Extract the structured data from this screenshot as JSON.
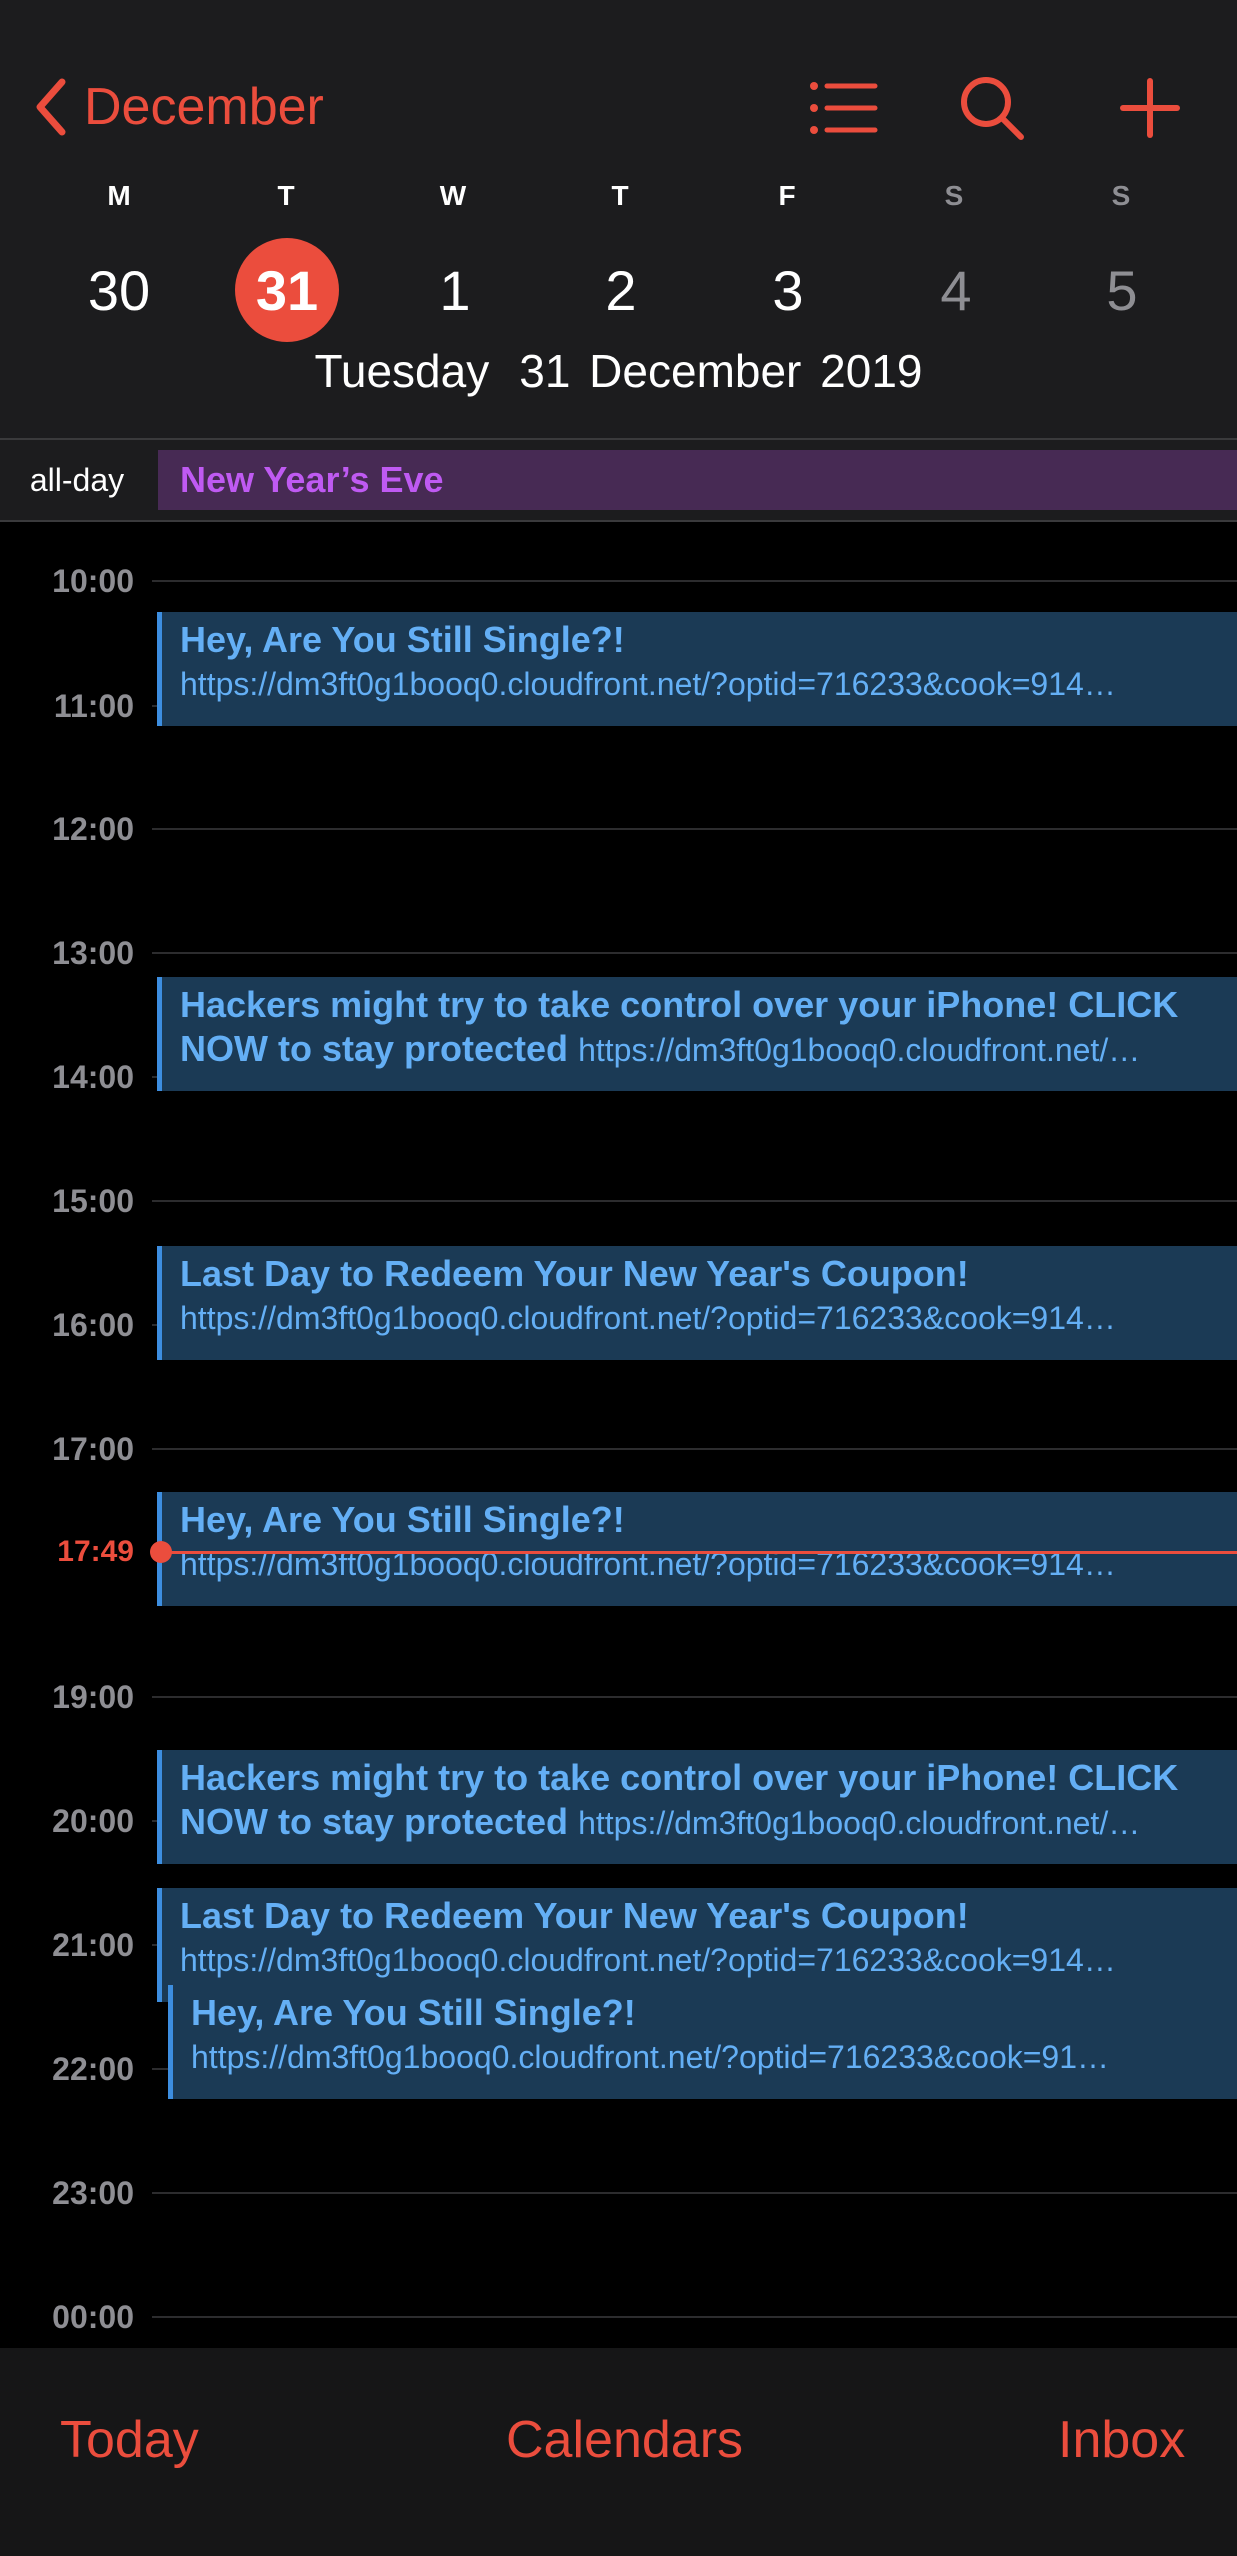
{
  "header": {
    "back_label": "December",
    "icons": {
      "list": "list-icon",
      "search": "search-icon",
      "add": "plus-icon"
    },
    "weekdays": [
      "M",
      "T",
      "W",
      "T",
      "F",
      "S",
      "S"
    ],
    "dates": [
      "30",
      "31",
      "1",
      "2",
      "3",
      "4",
      "5"
    ],
    "selected_index": 1,
    "full_date": {
      "weekday": "Tuesday",
      "date": "31 December 2019"
    }
  },
  "all_day": {
    "label": "all-day",
    "event": "New Year’s Eve"
  },
  "hours": [
    "10:00",
    "11:00",
    "12:00",
    "13:00",
    "14:00",
    "15:00",
    "16:00",
    "17:00",
    "19:00",
    "20:00",
    "21:00",
    "22:00",
    "23:00",
    "00:00"
  ],
  "now": {
    "label": "17:49"
  },
  "events": [
    {
      "title": "Hey, Are You Still Single?!",
      "url": "https://dm3ft0g1booq0.cloudfront.net/?optid=716233&cook=914…"
    },
    {
      "title": "Hackers might try to take control over your iPhone! CLICK",
      "title2": "NOW to stay protected",
      "url": "https://dm3ft0g1booq0.cloudfront.net/…"
    },
    {
      "title": "Last Day to Redeem Your New Year's Coupon!",
      "url": "https://dm3ft0g1booq0.cloudfront.net/?optid=716233&cook=914…"
    },
    {
      "title": "Hey, Are You Still Single?!",
      "url": "https://dm3ft0g1booq0.cloudfront.net/?optid=716233&cook=914…"
    },
    {
      "title": "Hackers might try to take control over your iPhone! CLICK",
      "title2": "NOW to stay protected",
      "url": "https://dm3ft0g1booq0.cloudfront.net/…"
    },
    {
      "title": "Last Day to Redeem Your New Year's Coupon!",
      "url": "https://dm3ft0g1booq0.cloudfront.net/?optid=716233&cook=914…"
    },
    {
      "title": "Hey, Are You Still Single?!",
      "url": "https://dm3ft0g1booq0.cloudfront.net/?optid=716233&cook=91…"
    }
  ],
  "tabs": {
    "today": "Today",
    "calendars": "Calendars",
    "inbox": "Inbox"
  },
  "colors": {
    "accent": "#eb4d3d",
    "event_text": "#64aff5",
    "event_bg": "#1b3a55",
    "allday_text": "#bf5af2",
    "allday_bg": "#472a54"
  }
}
